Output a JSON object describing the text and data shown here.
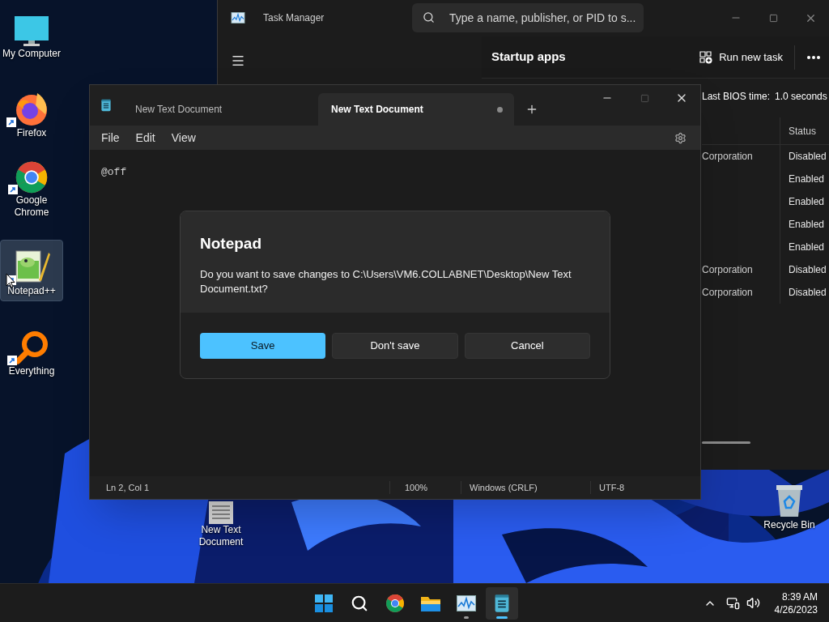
{
  "desktop_icons": [
    {
      "label": "My Computer",
      "kind": "computer",
      "shortcut": false,
      "selected": false
    },
    {
      "label": "Firefox",
      "kind": "firefox",
      "shortcut": true,
      "selected": false
    },
    {
      "label": "Google Chrome",
      "kind": "chrome",
      "shortcut": true,
      "selected": false
    },
    {
      "label": "Notepad++",
      "kind": "notepadpp",
      "shortcut": true,
      "selected": true
    },
    {
      "label": "Everything",
      "kind": "everything",
      "shortcut": true,
      "selected": false
    }
  ],
  "desktop_file": {
    "label": "New Text Document"
  },
  "recycle_bin": {
    "label": "Recycle Bin"
  },
  "task_manager": {
    "title": "Task Manager",
    "search": {
      "placeholder": "Type a name, publisher, or PID to s..."
    },
    "page_title": "Startup apps",
    "run_new_task": "Run new task",
    "bios_label": "Last BIOS time:",
    "bios_value": "1.0 seconds",
    "columns": [
      "Status"
    ],
    "rows": [
      {
        "publisher": "Corporation",
        "status": "Disabled"
      },
      {
        "status": "Enabled"
      },
      {
        "status": "Enabled"
      },
      {
        "status": "Enabled"
      },
      {
        "status": "Enabled"
      },
      {
        "publisher": "Corporation",
        "status": "Disabled"
      },
      {
        "publisher": "Corporation",
        "status": "Disabled"
      }
    ]
  },
  "notepad": {
    "tabs": [
      {
        "label": "New Text Document",
        "selected": false,
        "modified": false
      },
      {
        "label": "New Text Document",
        "selected": true,
        "modified": true
      }
    ],
    "menu": [
      "File",
      "Edit",
      "View"
    ],
    "content": "@off",
    "status_bar": [
      "Ln 2, Col 1",
      "100%",
      "Windows (CRLF)",
      "UTF-8"
    ]
  },
  "dialog": {
    "title": "Notepad",
    "message": "Do you want to save changes to C:\\Users\\VM6.COLLABNET\\Desktop\\New Text Document.txt?",
    "buttons": [
      {
        "label": "Save",
        "kind": "primary"
      },
      {
        "label": "Don't save",
        "kind": "secondary"
      },
      {
        "label": "Cancel",
        "kind": "secondary"
      }
    ]
  },
  "taskbar": {
    "apps": [
      {
        "kind": "start",
        "running": false,
        "active": false
      },
      {
        "kind": "search",
        "running": false,
        "active": false
      },
      {
        "kind": "chrome",
        "running": false,
        "active": false
      },
      {
        "kind": "explorer",
        "running": false,
        "active": false
      },
      {
        "kind": "taskmanager",
        "running": true,
        "active": false
      },
      {
        "kind": "notepad",
        "running": true,
        "active": true
      }
    ],
    "time": "8:39 AM",
    "date": "4/26/2023"
  }
}
